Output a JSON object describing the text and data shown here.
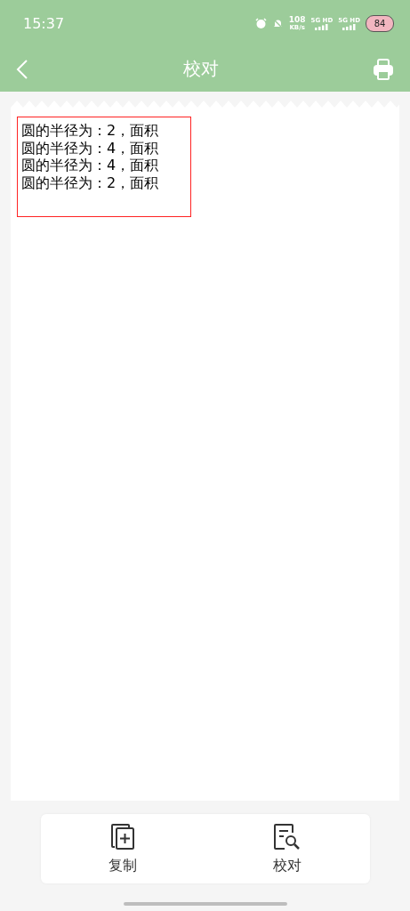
{
  "status_bar": {
    "time": "15:37",
    "speed": "108",
    "speed_unit": "KB/s",
    "sims": [
      {
        "label": "5G HD"
      },
      {
        "label": "5G HD"
      }
    ],
    "battery": "84"
  },
  "header": {
    "title": "校对"
  },
  "document": {
    "lines": [
      "圆的半径为：2，面积",
      "圆的半径为：4，面积",
      "圆的半径为：4，面积",
      "圆的半径为：2，面积"
    ]
  },
  "actions": [
    {
      "kind": "copy",
      "label": "复制"
    },
    {
      "kind": "proofread",
      "label": "校对"
    }
  ]
}
